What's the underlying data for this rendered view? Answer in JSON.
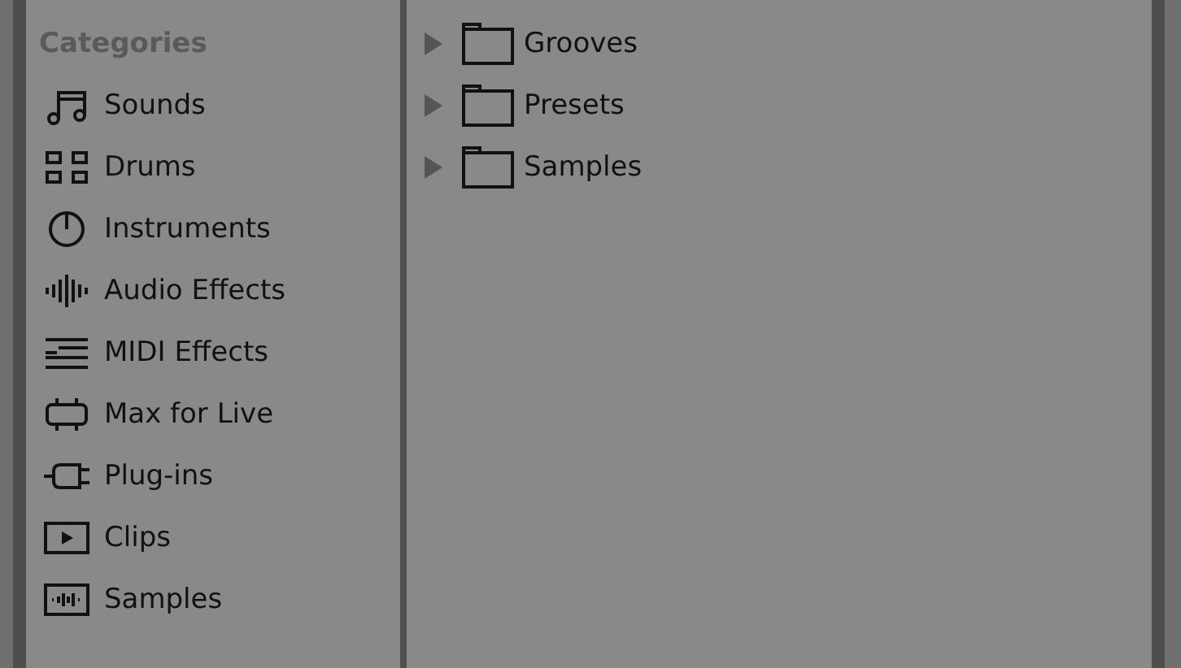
{
  "sidebar": {
    "heading": "Categories",
    "items": [
      {
        "label": "Sounds",
        "kind": "sounds"
      },
      {
        "label": "Drums",
        "kind": "drums"
      },
      {
        "label": "Instruments",
        "kind": "instruments"
      },
      {
        "label": "Audio Effects",
        "kind": "audio_effects"
      },
      {
        "label": "MIDI Effects",
        "kind": "midi_effects"
      },
      {
        "label": "Max for Live",
        "kind": "max_for_live"
      },
      {
        "label": "Plug-ins",
        "kind": "plugins"
      },
      {
        "label": "Clips",
        "kind": "clips"
      },
      {
        "label": "Samples",
        "kind": "samples"
      }
    ]
  },
  "browser": {
    "items": [
      {
        "label": "Grooves",
        "expanded": false
      },
      {
        "label": "Presets",
        "expanded": false
      },
      {
        "label": "Samples",
        "expanded": false
      }
    ]
  }
}
